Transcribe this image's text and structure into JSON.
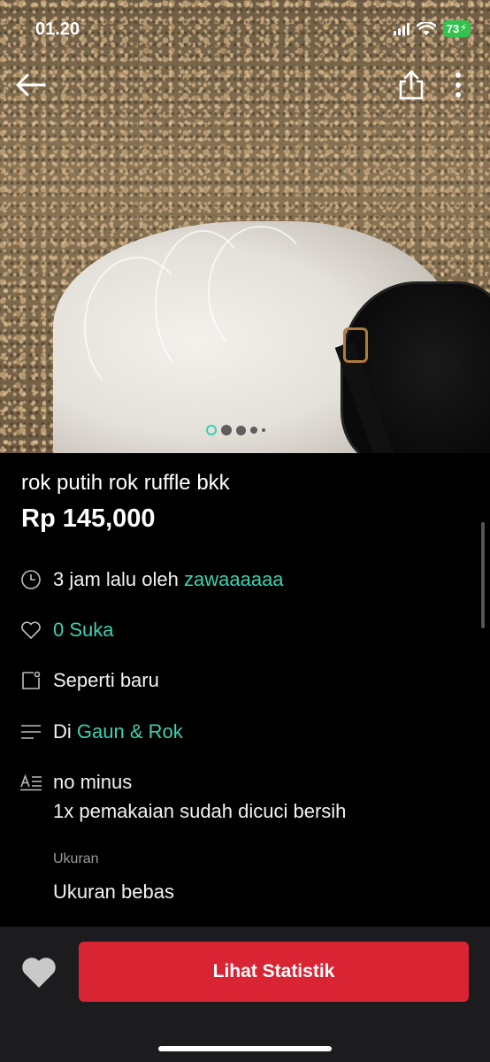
{
  "status_bar": {
    "time": "01.20",
    "battery": "73"
  },
  "nav": {
    "back_icon": "arrow-left-icon",
    "share_icon": "share-icon",
    "more_icon": "more-vertical-icon"
  },
  "carousel": {
    "total": 5,
    "active_index": 0
  },
  "listing": {
    "title": "rok putih rok ruffle bkk",
    "price": "Rp 145,000",
    "posted": {
      "prefix": "3 jam lalu oleh",
      "seller": "zawaaaaaa"
    },
    "likes": "0 Suka",
    "condition": "Seperti baru",
    "category": {
      "prefix": "Di",
      "name": "Gaun & Rok"
    },
    "description": [
      "no minus",
      "1x pemakaian sudah dicuci bersih"
    ],
    "size_label": "Ukuran",
    "size_value": "Ukuran bebas"
  },
  "bottom_bar": {
    "like_icon": "heart-icon",
    "cta_label": "Lihat Statistik"
  },
  "colors": {
    "accent": "#3bd1b0",
    "cta": "#d92433",
    "battery": "#33c24d"
  }
}
